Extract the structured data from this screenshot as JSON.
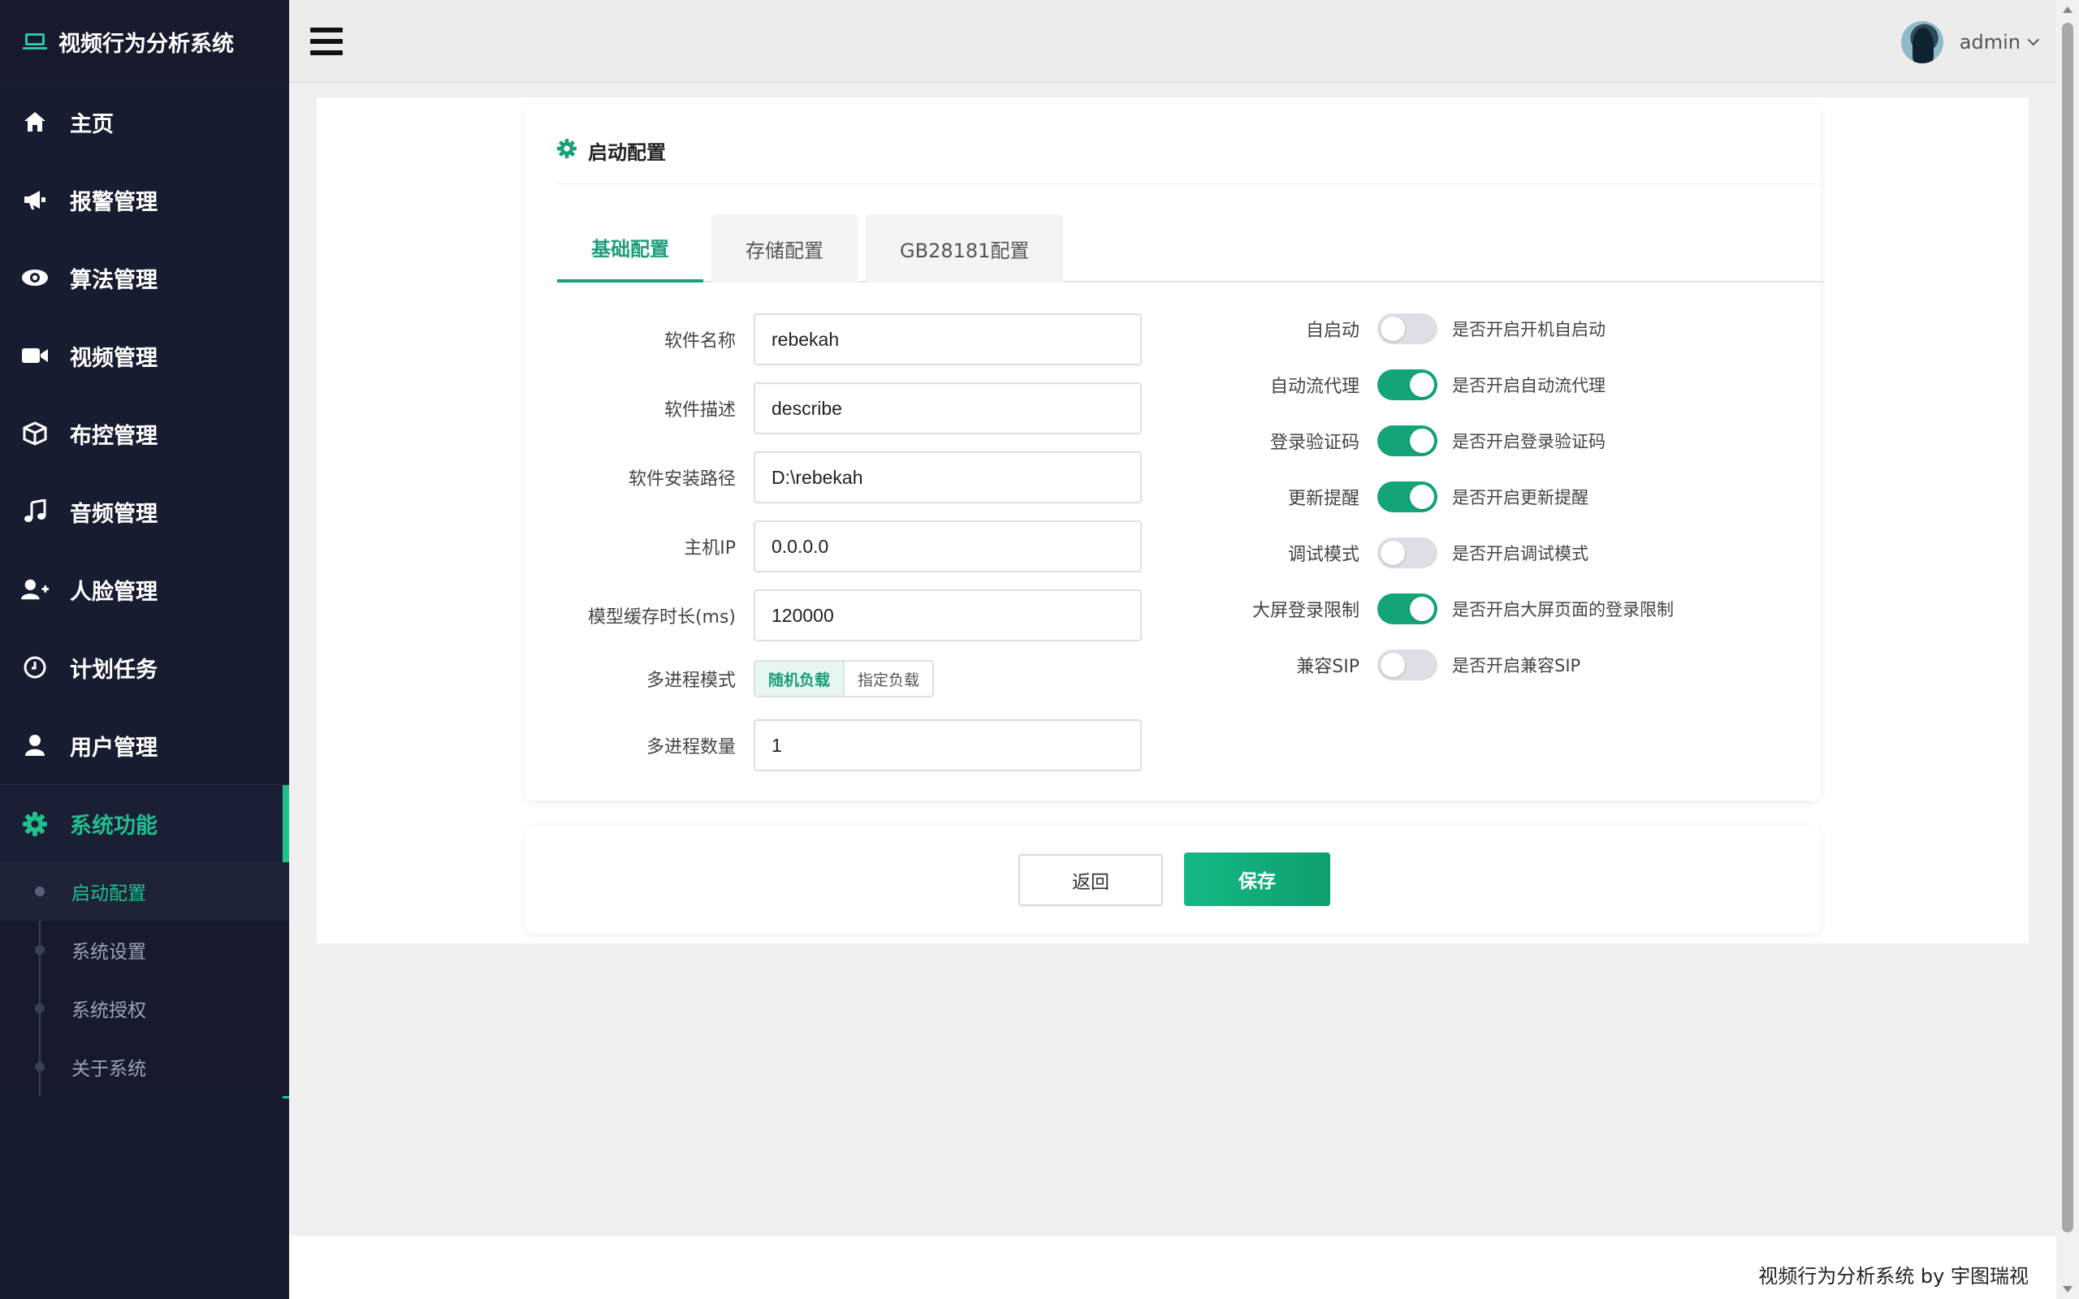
{
  "app": {
    "title": "视频行为分析系统"
  },
  "sidebar": {
    "items": [
      {
        "label": "主页",
        "icon": "home-icon"
      },
      {
        "label": "报警管理",
        "icon": "megaphone-icon"
      },
      {
        "label": "算法管理",
        "icon": "eye-icon"
      },
      {
        "label": "视频管理",
        "icon": "video-camera-icon"
      },
      {
        "label": "布控管理",
        "icon": "cube-icon"
      },
      {
        "label": "音频管理",
        "icon": "music-note-icon"
      },
      {
        "label": "人脸管理",
        "icon": "user-plus-icon"
      },
      {
        "label": "计划任务",
        "icon": "clock-icon"
      },
      {
        "label": "用户管理",
        "icon": "user-icon"
      },
      {
        "label": "系统功能",
        "icon": "gear-icon"
      }
    ],
    "subitems": [
      {
        "label": "启动配置"
      },
      {
        "label": "系统设置"
      },
      {
        "label": "系统授权"
      },
      {
        "label": "关于系统"
      }
    ]
  },
  "header": {
    "user": "admin"
  },
  "card": {
    "title": "启动配置",
    "tabs": [
      {
        "label": "基础配置"
      },
      {
        "label": "存储配置"
      },
      {
        "label": "GB28181配置"
      }
    ]
  },
  "form": {
    "software_name": {
      "label": "软件名称",
      "value": "rebekah"
    },
    "software_desc": {
      "label": "软件描述",
      "value": "describe"
    },
    "install_path": {
      "label": "软件安装路径",
      "value": "D:\\rebekah"
    },
    "host_ip": {
      "label": "主机IP",
      "value": "0.0.0.0"
    },
    "model_cache": {
      "label": "模型缓存时长(ms)",
      "value": "120000"
    },
    "multi_mode": {
      "label": "多进程模式",
      "options": [
        "随机负载",
        "指定负载"
      ],
      "selected": "随机负载"
    },
    "multi_count": {
      "label": "多进程数量",
      "value": "1"
    }
  },
  "toggles": [
    {
      "label": "自启动",
      "desc": "是否开启开机自启动",
      "on": false
    },
    {
      "label": "自动流代理",
      "desc": "是否开启自动流代理",
      "on": true
    },
    {
      "label": "登录验证码",
      "desc": "是否开启登录验证码",
      "on": true
    },
    {
      "label": "更新提醒",
      "desc": "是否开启更新提醒",
      "on": true
    },
    {
      "label": "调试模式",
      "desc": "是否开启调试模式",
      "on": false
    },
    {
      "label": "大屏登录限制",
      "desc": "是否开启大屏页面的登录限制",
      "on": true
    },
    {
      "label": "兼容SIP",
      "desc": "是否开启兼容SIP",
      "on": false
    }
  ],
  "actions": {
    "back": "返回",
    "save": "保存"
  },
  "footer": {
    "text": "视频行为分析系统 by 宇图瑞视"
  },
  "colors": {
    "accent": "#1a9e7c",
    "sidebar_bg": "#181c30",
    "toggle_on": "#13a47a"
  }
}
